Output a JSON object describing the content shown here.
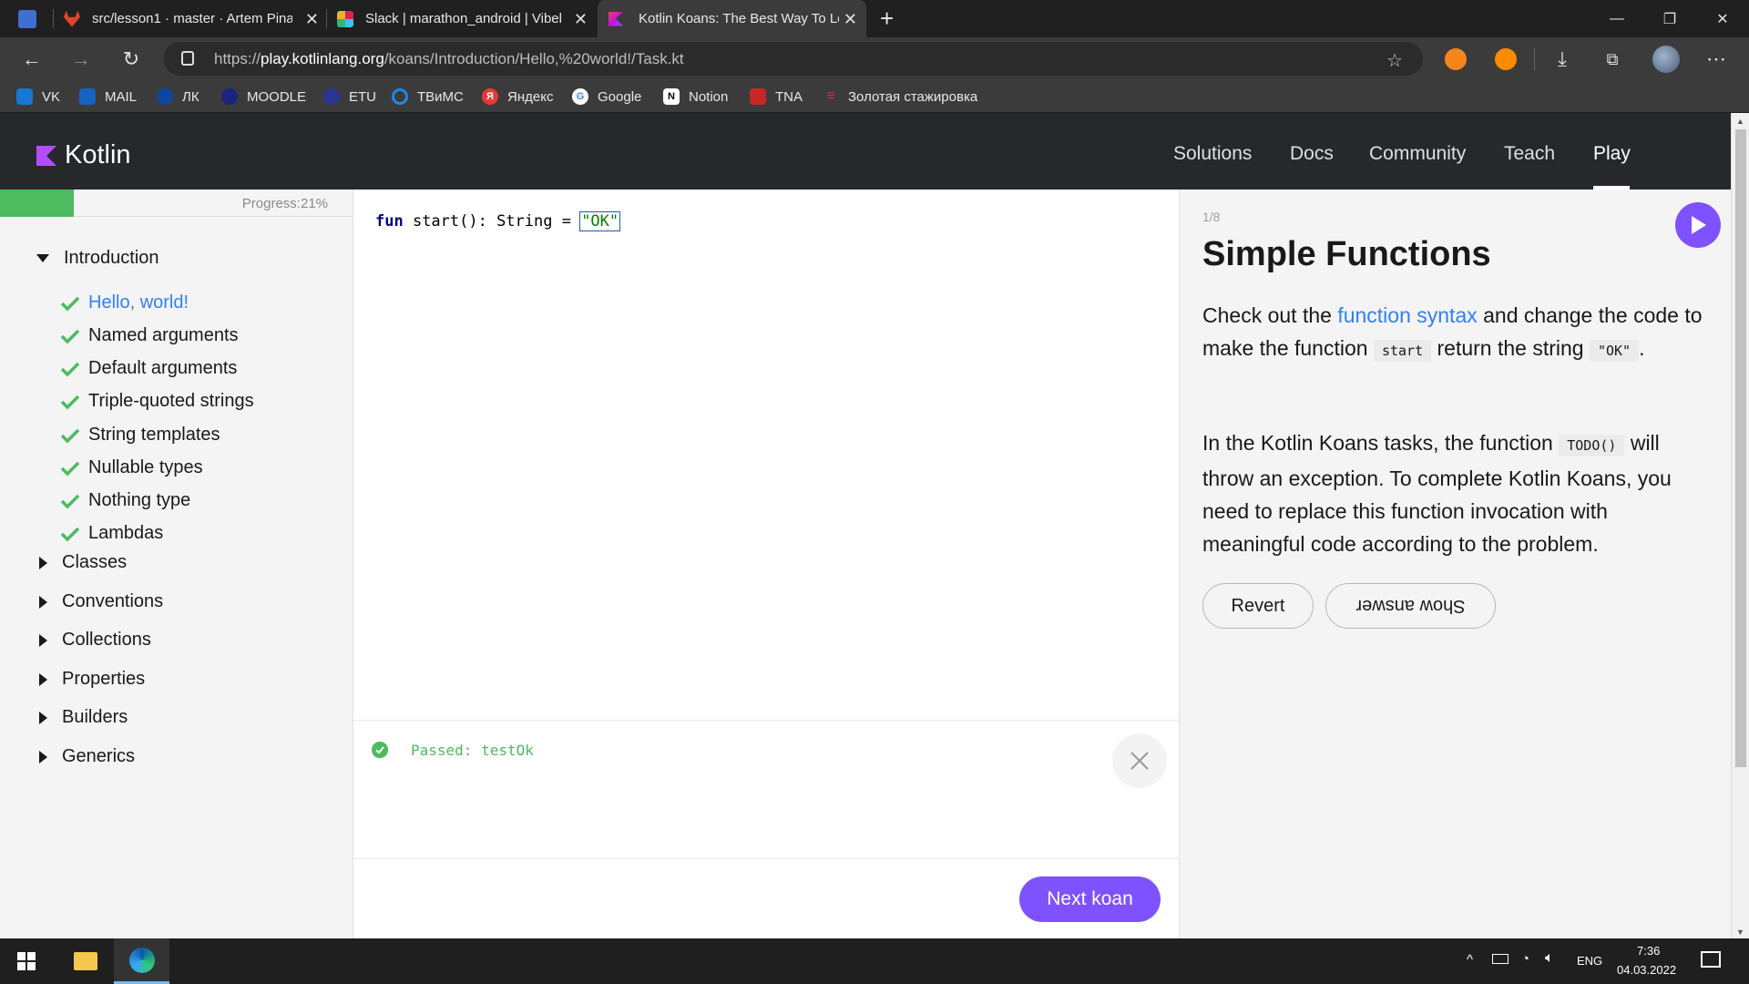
{
  "browser": {
    "tabs": [
      {
        "title": "",
        "active": false
      },
      {
        "title": "src/lesson1 · master · Artem Pina",
        "active": false
      },
      {
        "title": "Slack | marathon_android | Vibel",
        "active": false
      },
      {
        "title": "Kotlin Koans: The Best Way To Le",
        "active": true
      }
    ],
    "new_tab_label": "+",
    "url": {
      "prefix": "https://",
      "host": "play.kotlinlang.org",
      "path": "/koans/Introduction/Hello,%20world!/Task.kt"
    },
    "bookmarks": [
      {
        "label": "VK",
        "color": "#1976d2"
      },
      {
        "label": "MAIL",
        "color": "#1565c0"
      },
      {
        "label": "ЛК",
        "color": "#0d47a1"
      },
      {
        "label": "MOODLE",
        "color": "#1a237e"
      },
      {
        "label": "ETU",
        "color": "#283593"
      },
      {
        "label": "ТВиМС",
        "color": "#1e88e5"
      },
      {
        "label": "Яндекс",
        "color": "#e53935"
      },
      {
        "label": "Google",
        "color": "#ffffff"
      },
      {
        "label": "Notion",
        "color": "#ffffff"
      },
      {
        "label": "TNA",
        "color": "#c62828"
      },
      {
        "label": "Золотая стажировка",
        "color": "#e91e63"
      }
    ]
  },
  "site": {
    "logo_text": "Kotlin",
    "nav": [
      "Solutions",
      "Docs",
      "Community",
      "Teach",
      "Play"
    ],
    "active_nav": "Play"
  },
  "sidebar": {
    "progress_label": "Progress:21%",
    "progress_fraction": 0.21,
    "introduction": {
      "label": "Introduction",
      "lessons": [
        "Hello, world!",
        "Named arguments",
        "Default arguments",
        "Triple-quoted strings",
        "String templates",
        "Nullable types",
        "Nothing type",
        "Lambdas"
      ],
      "current": "Hello, world!"
    },
    "sections": [
      "Classes",
      "Conventions",
      "Collections",
      "Properties",
      "Builders",
      "Generics"
    ]
  },
  "editor": {
    "code": {
      "keyword": "fun",
      "signature": " start(): String = ",
      "string": "\"OK\""
    },
    "result": "Passed: testOk",
    "next_button": "Next koan"
  },
  "task": {
    "counter": "1/8",
    "title": "Simple Functions",
    "p1": {
      "t1": "Check out the ",
      "link": "function syntax",
      "t2": " and change the code to make the function ",
      "code1": "start",
      "t3": " return the string ",
      "code2": "\"OK\"",
      "t4": "."
    },
    "p2": {
      "t1": "In the Kotlin Koans tasks, the function ",
      "code1": "TODO()",
      "t2": " will throw an exception. To complete Kotlin Koans, you need to replace this function invocation with meaningful code according to the problem."
    },
    "revert_button": "Revert",
    "show_answer_button": "Show answer"
  },
  "taskbar": {
    "lang": "ENG",
    "time": "7:36",
    "date": "04.03.2022"
  },
  "colors": {
    "brand": "#7f52ff",
    "success": "#4dbb5f",
    "link": "#307fff"
  }
}
